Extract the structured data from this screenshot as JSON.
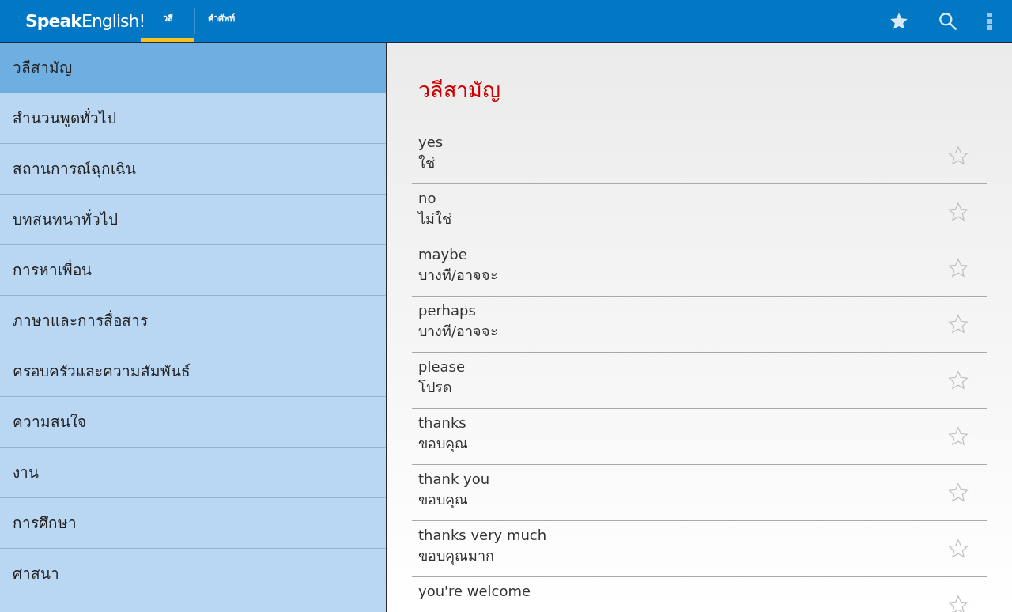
{
  "app_bar": {
    "logo": "**Speak**English!",
    "tabs": [
      {
        "label": "วลี",
        "selected": true
      },
      {
        "label": "คำศัพท์",
        "selected": false
      }
    ]
  },
  "sidebar": {
    "items": [
      {
        "label": "วลีสามัญ",
        "selected": true
      },
      {
        "label": "สำนวนพูดทั่วไป",
        "selected": false
      },
      {
        "label": "สถานการณ์ฉุกเฉิน",
        "selected": false
      },
      {
        "label": "บทสนทนาทั่วไป",
        "selected": false
      },
      {
        "label": "การหาเพื่อน",
        "selected": false
      },
      {
        "label": "ภาษาและการสื่อสาร",
        "selected": false
      },
      {
        "label": "ครอบครัวและความสัมพันธ์",
        "selected": false
      },
      {
        "label": "ความสนใจ",
        "selected": false
      },
      {
        "label": "งาน",
        "selected": false
      },
      {
        "label": "การศึกษา",
        "selected": false
      },
      {
        "label": "ศาสนา",
        "selected": false
      }
    ]
  },
  "content": {
    "title": "วลีสามัญ",
    "phrases": [
      {
        "english": "yes",
        "thai": "ใช่",
        "starred": false
      },
      {
        "english": "no",
        "thai": "ไม่ใช่",
        "starred": false
      },
      {
        "english": "maybe",
        "thai": "บางที/อาจจะ",
        "starred": false
      },
      {
        "english": "perhaps",
        "thai": "บางที/อาจจะ",
        "starred": false
      },
      {
        "english": "please",
        "thai": "โปรด",
        "starred": false
      },
      {
        "english": "thanks",
        "thai": "ขอบคุณ",
        "starred": false
      },
      {
        "english": "thank you",
        "thai": "ขอบคุณ",
        "starred": false
      },
      {
        "english": "thanks very much",
        "thai": "ขอบคุณมาก",
        "starred": false
      },
      {
        "english": "you're welcome",
        "starred": false
      }
    ]
  }
}
